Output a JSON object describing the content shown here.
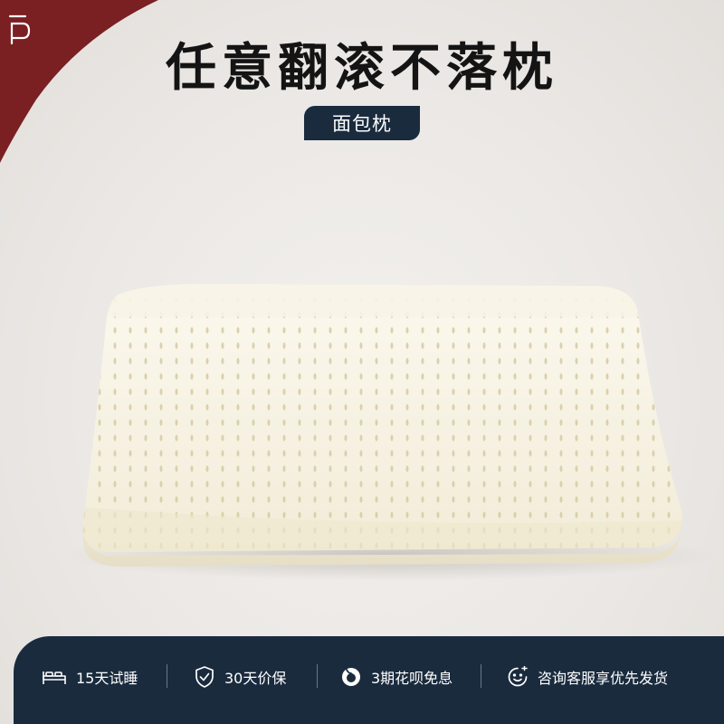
{
  "headline": "任意翻滚不落枕",
  "tag_label": "面包枕",
  "features": [
    {
      "icon": "bed-icon",
      "label": "15天试睡"
    },
    {
      "icon": "shield-check-icon",
      "label": "30天价保"
    },
    {
      "icon": "installment-icon",
      "label": "3期花呗免息"
    },
    {
      "icon": "customer-service-icon",
      "label": "咨询客服享优先发货"
    }
  ],
  "colors": {
    "navy": "#1a2b3e",
    "maroon": "#7a1f22",
    "background": "#ece9e6",
    "pillow": "#f6f1e0"
  }
}
